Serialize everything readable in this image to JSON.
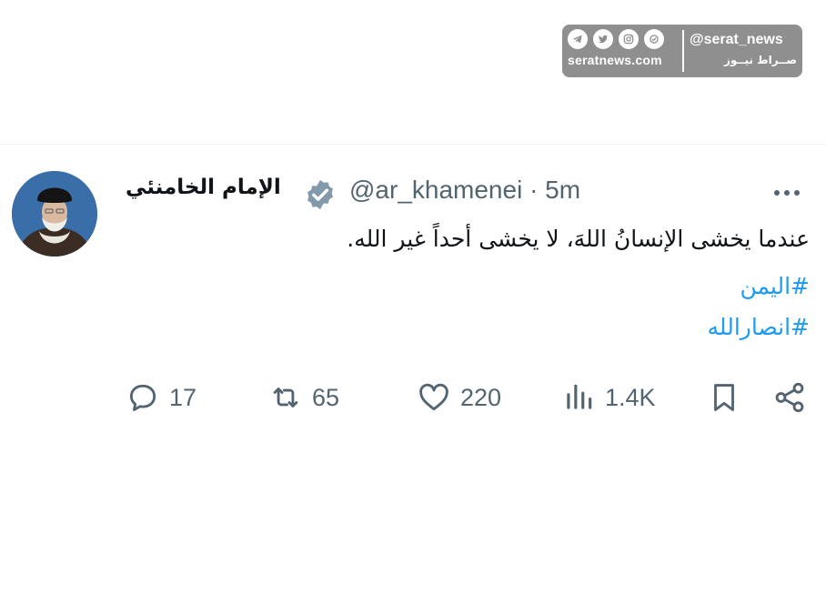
{
  "watermark": {
    "site": "seratnews.com",
    "handle": "@serat_news",
    "brand_fa": "صــراط نیــوز",
    "icons": [
      "telegram-icon",
      "twitter-icon",
      "instagram-icon",
      "aparat-icon"
    ]
  },
  "tweet": {
    "author_name": "الإمام الخامنئي",
    "handle_time": "@ar_khamenei · 5m",
    "text": "عندما يخشى الإنسانُ اللهَ، لا يخشى أحداً غير الله.",
    "hashtags": [
      "#اليمن",
      "#انصارالله"
    ],
    "actions": {
      "replies": "17",
      "retweets": "65",
      "likes": "220",
      "views": "1.4K"
    }
  },
  "colors": {
    "accent": "#1d9bf0",
    "muted": "#536471",
    "text": "#0f1419",
    "watermark_bg": "#8f8f8f"
  }
}
